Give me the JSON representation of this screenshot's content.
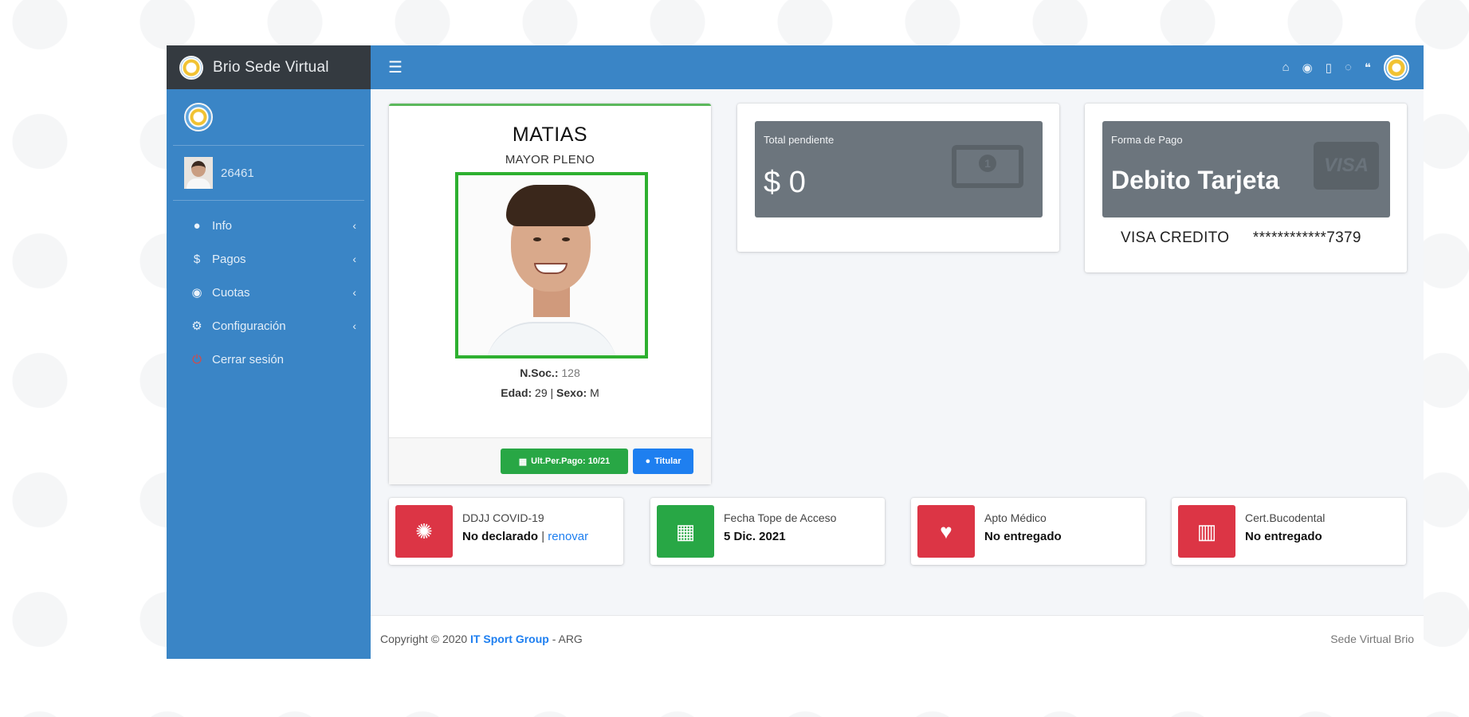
{
  "app": {
    "brand_title": "Brio Sede Virtual"
  },
  "sidebar": {
    "user_id": "26461",
    "nav": [
      {
        "icon": "info-circle-icon",
        "label": "Info"
      },
      {
        "icon": "dollar-icon",
        "label": "Pagos"
      },
      {
        "icon": "database-icon",
        "label": "Cuotas"
      },
      {
        "icon": "cogs-icon",
        "label": "Configuración"
      },
      {
        "icon": "power-icon",
        "label": "Cerrar sesión"
      }
    ]
  },
  "header": {
    "icons": [
      "home-icon",
      "eye-icon",
      "file-icon",
      "whatsapp-icon",
      "comments-icon",
      "club-logo-icon"
    ]
  },
  "profile": {
    "name": "MATIAS",
    "category": "MAYOR PLENO",
    "nsoc_label": "N.Soc.:",
    "nsoc_value": "128",
    "edad_label": "Edad:",
    "edad_value": "29",
    "sexo_label": "Sexo:",
    "sexo_value": "M",
    "pay_button": "Ult.Per.Pago: 10/21",
    "holder_button": "Titular"
  },
  "pending": {
    "title": "Total pendiente",
    "value": "$ 0"
  },
  "payment": {
    "title": "Forma de Pago",
    "value": "Debito Tarjeta",
    "card_type": "VISA CREDITO",
    "card_number": "************7379",
    "card_brand": "VISA"
  },
  "info_boxes": [
    {
      "icon": "virus-icon",
      "color": "#dc3545",
      "label": "DDJJ COVID-19",
      "value": "No declarado",
      "sep": " | ",
      "link": "renovar"
    },
    {
      "icon": "calendar-icon",
      "color": "#28a745",
      "label": "Fecha Tope de Acceso",
      "value": "5 Dic. 2021"
    },
    {
      "icon": "heartbeat-icon",
      "color": "#dc3545",
      "label": "Apto Médico",
      "value": "No entregado"
    },
    {
      "icon": "teeth-icon",
      "color": "#dc3545",
      "label": "Cert.Bucodental",
      "value": "No entregado"
    }
  ],
  "footer": {
    "copyright": "Copyright © 2020",
    "company": "IT Sport Group",
    "suffix": "- ARG",
    "right_text": "Sede Virtual Brio"
  }
}
